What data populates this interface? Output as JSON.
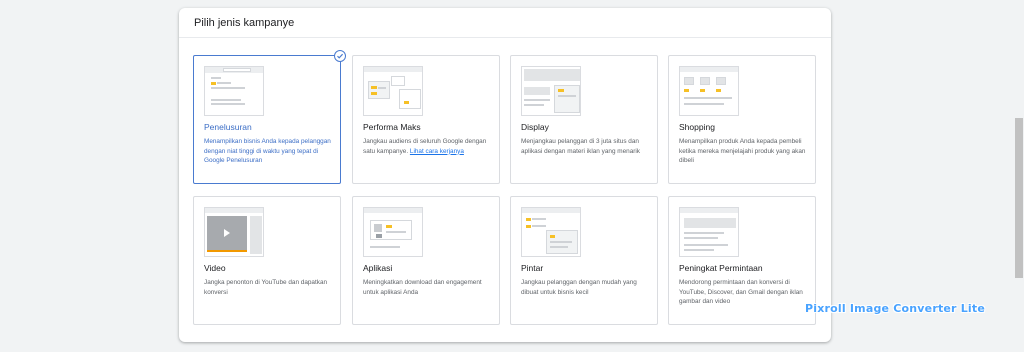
{
  "section": {
    "title": "Pilih jenis kampanye"
  },
  "cards": [
    {
      "title": "Penelusuran",
      "desc": "Menampilkan bisnis Anda kepada pelanggan dengan niat tinggi di waktu yang tepat di Google Penelusuran",
      "selected": true
    },
    {
      "title": "Performa Maks",
      "desc": "Jangkau audiens di seluruh Google dengan satu kampanye. ",
      "link": "Lihat cara kerjanya"
    },
    {
      "title": "Display",
      "desc": "Menjangkau pelanggan di 3 juta situs dan aplikasi dengan materi iklan yang menarik"
    },
    {
      "title": "Shopping",
      "desc": "Menampilkan produk Anda kepada pembeli ketika mereka menjelajahi produk yang akan dibeli"
    },
    {
      "title": "Video",
      "desc": "Jangka penonton di YouTube dan dapatkan konversi"
    },
    {
      "title": "Aplikasi",
      "desc": "Meningkatkan download dan engagement untuk aplikasi Anda"
    },
    {
      "title": "Pintar",
      "desc": "Jangkau pelanggan dengan mudah yang dibuat untuk bisnis kecil"
    },
    {
      "title": "Peningkat Permintaan",
      "desc": "Mendorong permintaan dan konversi di YouTube, Discover, dan Gmail dengan iklan gambar dan video"
    }
  ],
  "watermark": "Pixroll Image Converter Lite",
  "colors": {
    "accent": "#4a7bd0",
    "yellow": "#f6c026",
    "link": "#1a73e8"
  }
}
